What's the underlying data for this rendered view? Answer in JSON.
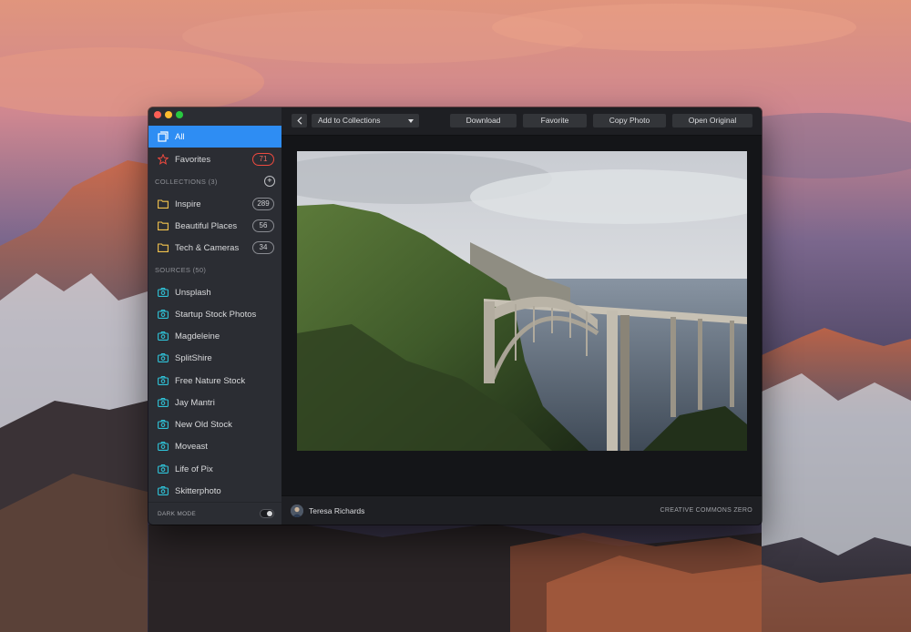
{
  "sidebar": {
    "primary": [
      {
        "label": "All",
        "icon": "stack-icon",
        "active": true
      },
      {
        "label": "Favorites",
        "icon": "star-icon",
        "badge": "71"
      }
    ],
    "collections_header": "COLLECTIONS (3)",
    "collections": [
      {
        "label": "Inspire",
        "badge": "289",
        "icon": "folder-icon"
      },
      {
        "label": "Beautiful Places",
        "badge": "56",
        "icon": "folder-icon"
      },
      {
        "label": "Tech & Cameras",
        "badge": "34",
        "icon": "folder-icon"
      }
    ],
    "sources_header": "SOURCES (50)",
    "sources": [
      {
        "label": "Unsplash",
        "icon": "camera-icon"
      },
      {
        "label": "Startup Stock Photos",
        "icon": "camera-icon"
      },
      {
        "label": "Magdeleine",
        "icon": "camera-icon"
      },
      {
        "label": "SplitShire",
        "icon": "camera-icon"
      },
      {
        "label": "Free Nature Stock",
        "icon": "camera-icon"
      },
      {
        "label": "Jay Mantri",
        "icon": "camera-icon"
      },
      {
        "label": "New Old Stock",
        "icon": "camera-icon"
      },
      {
        "label": "Moveast",
        "icon": "camera-icon"
      },
      {
        "label": "Life of Pix",
        "icon": "camera-icon"
      },
      {
        "label": "Skitterphoto",
        "icon": "camera-icon"
      }
    ],
    "footer": {
      "label": "DARK MODE",
      "toggle_on": true
    }
  },
  "toolbar": {
    "back_icon": "chevron-left-icon",
    "collections_select": "Add to Collections",
    "download": "Download",
    "favorite": "Favorite",
    "copy_photo": "Copy Photo",
    "open_original": "Open Original"
  },
  "status": {
    "author": "Teresa Richards",
    "license": "CREATIVE COMMONS ZERO"
  },
  "colors": {
    "accent": "#2e8df3",
    "folder": "#f3c44e",
    "source": "#2fc3d8",
    "favorite": "#ef4a3f"
  }
}
